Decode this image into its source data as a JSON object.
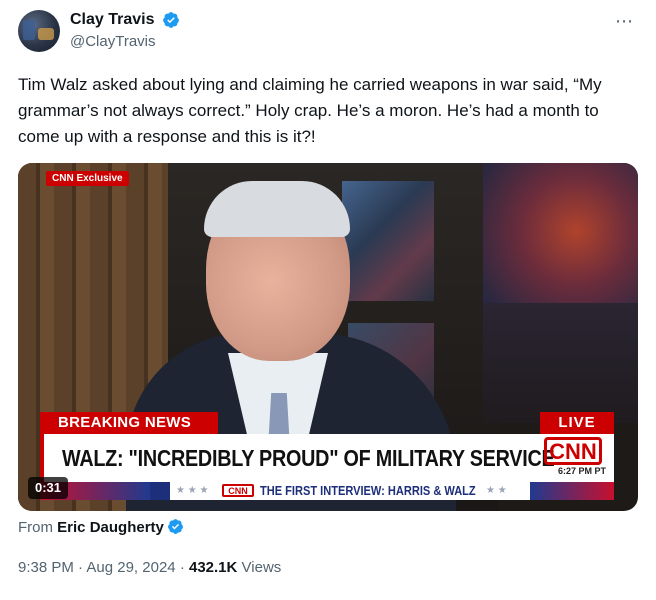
{
  "author": {
    "display_name": "Clay Travis",
    "handle": "@ClayTravis"
  },
  "tweet": {
    "text": "Tim Walz asked about lying and claiming he carried weapons in war said, “My grammar’s not always correct.” Holy crap. He’s a moron. He’s had a month to come up with a response and this is it?!"
  },
  "video": {
    "exclusive_label": "CNN Exclusive",
    "breaking_label": "BREAKING NEWS",
    "live_label": "LIVE",
    "headline": "WALZ: \"INCREDIBLY PROUD\" OF MILITARY SERVICE",
    "logo": "CNN",
    "timestamp": "6:27 PM PT",
    "ticker_logo": "CNN",
    "ticker_text": "THE FIRST INTERVIEW: HARRIS & WALZ",
    "duration": "0:31"
  },
  "source": {
    "prefix": "From",
    "name": "Eric Daugherty"
  },
  "meta": {
    "time": "9:38 PM",
    "separator": "·",
    "date": "Aug 29, 2024",
    "views_count": "432.1K",
    "views_label": "Views"
  },
  "icons": {
    "verified": "verified-badge-icon",
    "more": "more-icon"
  },
  "colors": {
    "verified_blue": "#1d9bf0",
    "cnn_red": "#cc0000"
  }
}
